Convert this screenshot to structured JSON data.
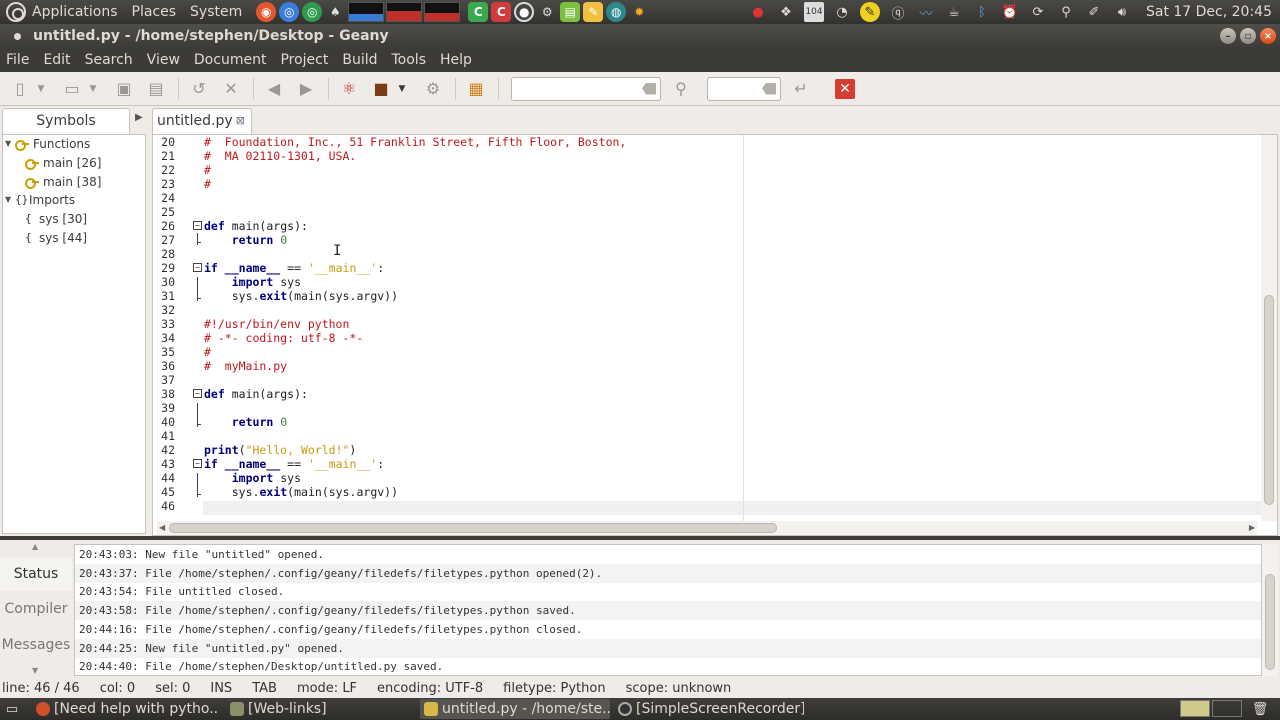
{
  "top_panel": {
    "menus": [
      "Applications",
      "Places",
      "System"
    ],
    "tray_labels": {
      "battery": "104"
    },
    "clock": "Sat 17 Dec, 20:45"
  },
  "window": {
    "title": "untitled.py - /home/stephen/Desktop - Geany"
  },
  "menubar": [
    "File",
    "Edit",
    "Search",
    "View",
    "Document",
    "Project",
    "Build",
    "Tools",
    "Help"
  ],
  "toolbar": {
    "search_value": "",
    "goto_line_value": ""
  },
  "sidebar": {
    "tab_label": "Symbols",
    "tree": [
      {
        "label": "Functions",
        "type": "group"
      },
      {
        "label": "main [26]",
        "type": "function"
      },
      {
        "label": "main [38]",
        "type": "function"
      },
      {
        "label": "Imports",
        "type": "group"
      },
      {
        "label": "sys [30]",
        "type": "import"
      },
      {
        "label": "sys [44]",
        "type": "import"
      }
    ]
  },
  "editor": {
    "tab_label": "untitled.py",
    "lines": [
      {
        "n": "20",
        "t": "#  Foundation, Inc., 51 Franklin Street, Fifth Floor, Boston,"
      },
      {
        "n": "21",
        "t": "#  MA 02110-1301, USA."
      },
      {
        "n": "22",
        "t": "#"
      },
      {
        "n": "23",
        "t": "#"
      },
      {
        "n": "24",
        "t": ""
      },
      {
        "n": "25",
        "t": ""
      },
      {
        "n": "26",
        "t": "def main(args):"
      },
      {
        "n": "27",
        "t": "    return 0"
      },
      {
        "n": "28",
        "t": ""
      },
      {
        "n": "29",
        "t": "if __name__ == '__main__':"
      },
      {
        "n": "30",
        "t": "    import sys"
      },
      {
        "n": "31",
        "t": "    sys.exit(main(sys.argv))"
      },
      {
        "n": "32",
        "t": ""
      },
      {
        "n": "33",
        "t": "#!/usr/bin/env python"
      },
      {
        "n": "34",
        "t": "# -*- coding: utf-8 -*-"
      },
      {
        "n": "35",
        "t": "#"
      },
      {
        "n": "36",
        "t": "#  myMain.py"
      },
      {
        "n": "37",
        "t": ""
      },
      {
        "n": "38",
        "t": "def main(args):"
      },
      {
        "n": "39",
        "t": ""
      },
      {
        "n": "40",
        "t": "    return 0"
      },
      {
        "n": "41",
        "t": ""
      },
      {
        "n": "42",
        "t": "print(\"Hello, World!\")"
      },
      {
        "n": "43",
        "t": "if __name__ == '__main__':"
      },
      {
        "n": "44",
        "t": "    import sys"
      },
      {
        "n": "45",
        "t": "    sys.exit(main(sys.argv))"
      },
      {
        "n": "46",
        "t": ""
      }
    ]
  },
  "messages": {
    "tabs": [
      "Status",
      "Compiler",
      "Messages"
    ],
    "active_tab": "Status",
    "lines": [
      "20:43:03: New file \"untitled\" opened.",
      "20:43:37: File /home/stephen/.config/geany/filedefs/filetypes.python opened(2).",
      "20:43:54: File untitled closed.",
      "20:43:58: File /home/stephen/.config/geany/filedefs/filetypes.python saved.",
      "20:44:16: File /home/stephen/.config/geany/filedefs/filetypes.python closed.",
      "20:44:25: New file \"untitled.py\" opened.",
      "20:44:40: File /home/stephen/Desktop/untitled.py saved."
    ]
  },
  "statusbar": {
    "line": "line: 46 / 46",
    "col": "col: 0",
    "sel": "sel: 0",
    "ins": "INS",
    "tab": "TAB",
    "mode": "mode: LF",
    "encoding": "encoding: UTF-8",
    "filetype": "filetype: Python",
    "scope": "scope: unknown"
  },
  "taskbar": {
    "tasks": [
      "[Need help with pytho...",
      "[Web-links]",
      "untitled.py - /home/ste...",
      "[SimpleScreenRecorder]"
    ]
  }
}
